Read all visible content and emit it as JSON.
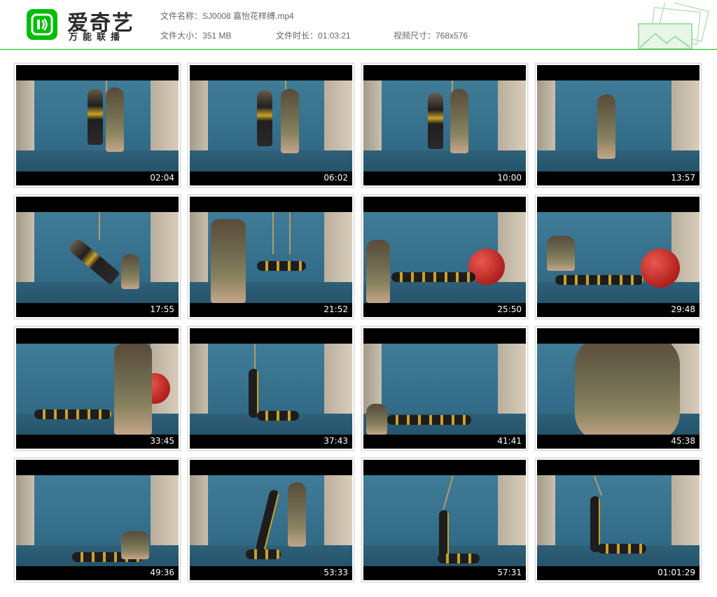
{
  "app": {
    "brand": "爱奇艺",
    "tagline": "万能联播"
  },
  "file": {
    "name_label": "文件名称：",
    "name_value": "SJ0008 嘉怡花样缚.mp4",
    "size_label": "文件大小：",
    "size_value": "351 MB",
    "duration_label": "文件时长：",
    "duration_value": "01:03:21",
    "resolution_label": "视频尺寸：",
    "resolution_value": "768x576"
  },
  "thumbnails": [
    {
      "time": "02:04"
    },
    {
      "time": "06:02"
    },
    {
      "time": "10:00"
    },
    {
      "time": "13:57"
    },
    {
      "time": "17:55"
    },
    {
      "time": "21:52"
    },
    {
      "time": "25:50"
    },
    {
      "time": "29:48"
    },
    {
      "time": "33:45"
    },
    {
      "time": "37:43"
    },
    {
      "time": "41:41"
    },
    {
      "time": "45:38"
    },
    {
      "time": "49:36"
    },
    {
      "time": "53:33"
    },
    {
      "time": "57:31"
    },
    {
      "time": "01:01:29"
    }
  ],
  "colors": {
    "brand_green": "#00be06",
    "header_rule": "#00be06",
    "backdrop_blue": "#3f7c98"
  },
  "icons": [
    "iqiyi-logo-icon",
    "photo-stack-decoration-icon"
  ]
}
